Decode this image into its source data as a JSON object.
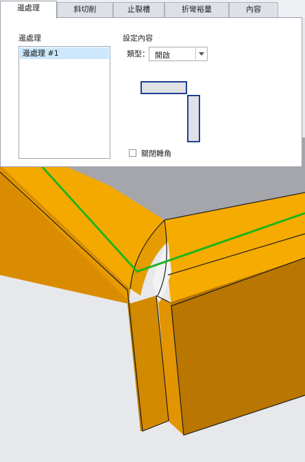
{
  "tabs": [
    {
      "label": "邊處理",
      "active": true
    },
    {
      "label": "斜切削",
      "active": false
    },
    {
      "label": "止裂槽",
      "active": false
    },
    {
      "label": "折彎裕量",
      "active": false
    },
    {
      "label": "內容",
      "active": false
    }
  ],
  "panel": {
    "edge_list_title": "邊處理",
    "edge_items": [
      "邊處理 #1"
    ],
    "settings_title": "設定內容",
    "type_label": "類型：",
    "type_value": "開啟",
    "close_corner_label": "關閉轉角",
    "close_corner_checked": false
  },
  "colors": {
    "part_orange": "#f2a200",
    "part_shadow": "#c98200",
    "edge_highlight": "#1cb51c",
    "preview_outline": "#1c3f8f",
    "background": "#e7e8ec"
  }
}
